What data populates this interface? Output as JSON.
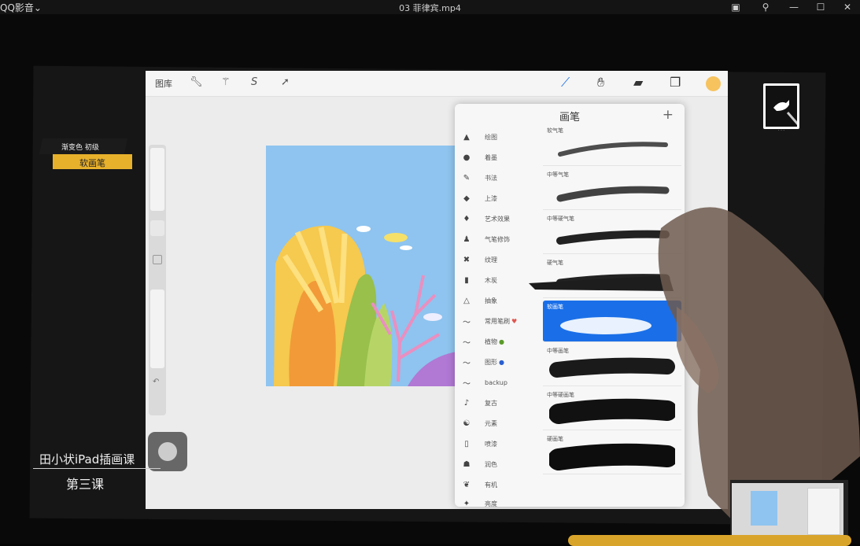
{
  "window": {
    "app_name": "QQ影音",
    "title": "03 菲律宾.mp4",
    "controls": [
      "pip-icon",
      "pin-icon",
      "minimize-icon",
      "maximize-icon",
      "close-icon"
    ]
  },
  "procreate": {
    "gallery_label": "图库",
    "toolbar_tools": [
      "wrench-icon",
      "magic-wand-icon",
      "selection-icon",
      "transform-icon"
    ],
    "right_tools": [
      "brush-icon",
      "smudge-icon",
      "eraser-icon",
      "layers-icon"
    ],
    "current_color": "#f6c35f",
    "brush_panel": {
      "title": "画笔",
      "add_symbol": "+",
      "categories": [
        {
          "label": "绘图",
          "icon": "pencil-icon"
        },
        {
          "label": "着墨",
          "icon": "ink-drop-icon"
        },
        {
          "label": "书法",
          "icon": "calligraphy-icon"
        },
        {
          "label": "上漆",
          "icon": "paint-icon"
        },
        {
          "label": "艺术效果",
          "icon": "artistic-icon"
        },
        {
          "label": "气笔修饰",
          "icon": "airbrush-icon"
        },
        {
          "label": "纹理",
          "icon": "texture-icon"
        },
        {
          "label": "木炭",
          "icon": "charcoal-icon"
        },
        {
          "label": "抽象",
          "icon": "abstract-icon"
        },
        {
          "label": "常用笔刷",
          "icon": "brush-stroke-icon",
          "badge": "heart"
        },
        {
          "label": "植物",
          "icon": "brush-stroke-icon",
          "badge": "green-ball"
        },
        {
          "label": "图形",
          "icon": "brush-stroke-icon",
          "badge": "blue-ball"
        },
        {
          "label": "backup",
          "icon": "brush-stroke-icon"
        },
        {
          "label": "复古",
          "icon": "retro-icon"
        },
        {
          "label": "元素",
          "icon": "elements-icon"
        },
        {
          "label": "喷漆",
          "icon": "spray-icon"
        },
        {
          "label": "润色",
          "icon": "touchup-icon"
        },
        {
          "label": "有机",
          "icon": "organic-icon"
        },
        {
          "label": "亮度",
          "icon": "luminance-icon"
        }
      ],
      "brushes": [
        {
          "name": "软气笔",
          "selected": false
        },
        {
          "name": "中等气笔",
          "selected": false
        },
        {
          "name": "中等硬气笔",
          "selected": false
        },
        {
          "name": "硬气笔",
          "selected": false
        },
        {
          "name": "软画笔",
          "selected": true
        },
        {
          "name": "中等画笔",
          "selected": false
        },
        {
          "name": "中等硬画笔",
          "selected": false
        },
        {
          "name": "硬画笔",
          "selected": false
        }
      ]
    }
  },
  "overlay": {
    "badge_top": "渐变色 初级",
    "badge_bottom": "软画笔",
    "course_title": "田小状iPad插画课",
    "course_lesson": "第三课"
  },
  "colors": {
    "sky": "#8ec4ef",
    "accent_blue": "#1a6fe8",
    "badge_yellow": "#e8b12c"
  }
}
